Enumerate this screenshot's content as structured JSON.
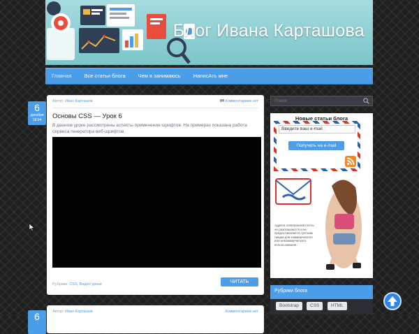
{
  "header": {
    "site_title": "Блог Ивана Карташова"
  },
  "nav": {
    "items": [
      "Главная",
      "Все статьи блога",
      "Чем я занимаюсь",
      "НаписАть мне"
    ]
  },
  "post": {
    "date": {
      "day": "6",
      "month": "декабря",
      "time": "18:04"
    },
    "author_label": "Автор:",
    "author": "Иван Карташов",
    "comments": "Комментариев нет",
    "title": "Основы CSS — Урок 6",
    "excerpt": "В данном уроке рассмотрены аспекты применения шрифтов. На примерах показана работа сервиса генератора веб-шрифтов.",
    "categories_label": "Рубрики:",
    "categories": "CSS, Видео уроки",
    "read_button": "ЧИТАТЬ"
  },
  "post2": {
    "date": {
      "day": "6"
    },
    "author_label": "Автор:",
    "author": "Иван Карташов",
    "comments": "Комментариев нет"
  },
  "sidebar": {
    "search_placeholder": "Поиск",
    "new_posts_title": "Новые статьи блога",
    "email_placeholder": "Введите ваш e-mail",
    "subscribe_button": "Получать на e-mail",
    "privacy_note": "Адреса электронной почты не разглашаются и не предоставляются третьим лицам для коммерческого или некоммерческого использования.",
    "categories_title": "Рубрики блога",
    "tags": [
      "Bootstrap",
      "CSS",
      "HTML"
    ]
  },
  "colors": {
    "accent": "#4d9ee9",
    "header_bg": "#8fcfd4",
    "page_bg": "#1f1f1f"
  },
  "icons": [
    "search-icon",
    "rss-icon",
    "comment-icon",
    "arrow-up-icon"
  ]
}
